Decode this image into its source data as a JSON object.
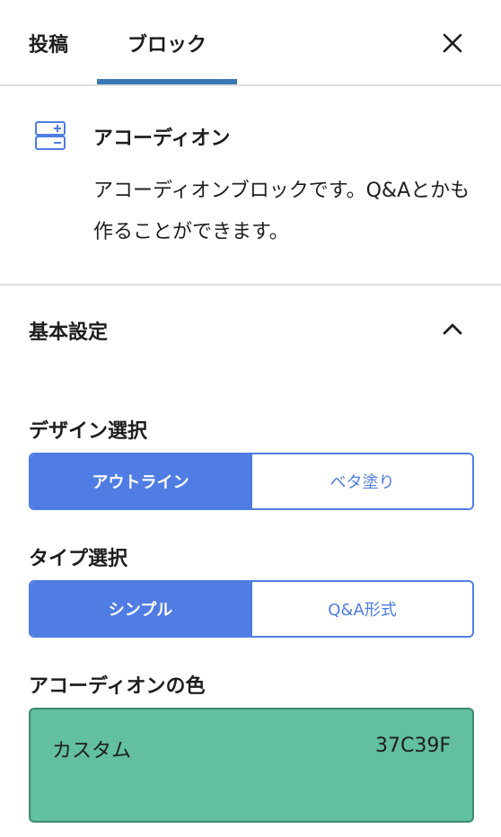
{
  "tabs": {
    "post_label": "投稿",
    "block_label": "ブロック",
    "active": "block",
    "close_icon": "close-icon"
  },
  "block": {
    "icon": "accordion-block-icon",
    "title": "アコーディオン",
    "description": "アコーディオンブロックです。Q&Aとかも作ることができます。"
  },
  "panel": {
    "title": "基本設定",
    "expanded": true,
    "toggle_icon": "chevron-up-icon"
  },
  "design_select": {
    "label": "デザイン選択",
    "options": [
      "アウトライン",
      "ベタ塗り"
    ],
    "selected": "アウトライン"
  },
  "type_select": {
    "label": "タイプ選択",
    "options": [
      "シンプル",
      "Q&A形式"
    ],
    "selected": "シンプル"
  },
  "accordion_color": {
    "label": "アコーディオンの色",
    "name": "カスタム",
    "hex": "37C39F",
    "swatch_color": "#62bf9f"
  },
  "colors": {
    "accent": "#4f7de4",
    "tab_indicator": "#3a78b5",
    "icon": "#4f7de4"
  }
}
